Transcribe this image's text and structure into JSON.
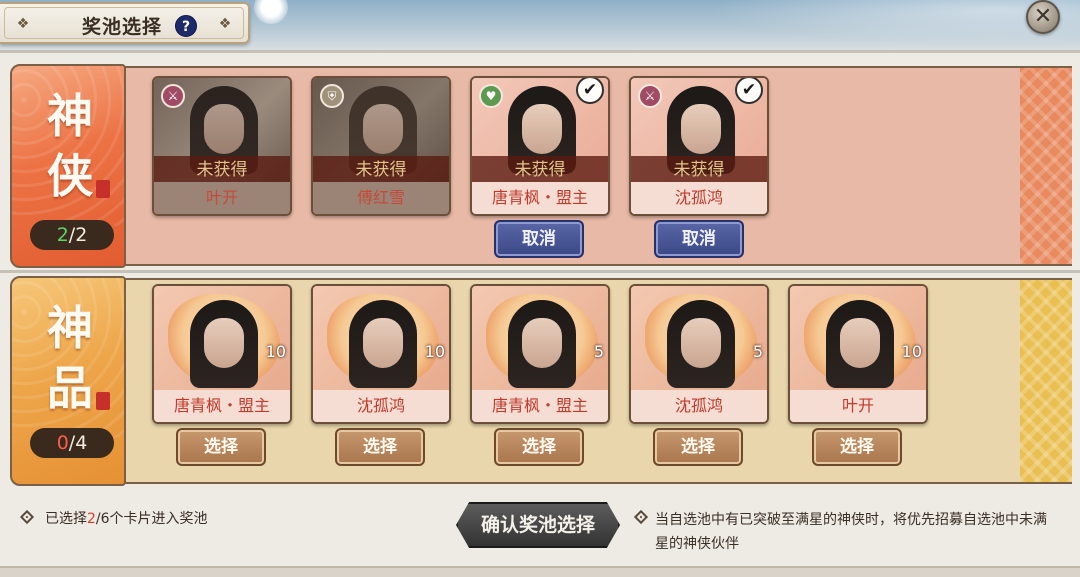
{
  "header": {
    "title": "奖池选择",
    "help_icon": "?",
    "close_icon": "✕"
  },
  "rows": {
    "god": {
      "glyph_top": "神",
      "glyph_bottom": "侠",
      "count_selected": "2",
      "count_total": "2",
      "cards": [
        {
          "status": "未获得",
          "name": "叶开",
          "role": "warrior",
          "selected": false,
          "action": ""
        },
        {
          "status": "未获得",
          "name": "傅红雪",
          "role": "guard",
          "selected": false,
          "action": ""
        },
        {
          "status": "未获得",
          "name": "唐青枫・盟主",
          "role": "heal",
          "selected": true,
          "action": "取消"
        },
        {
          "status": "未获得",
          "name": "沈孤鸿",
          "role": "warrior",
          "selected": true,
          "action": "取消"
        }
      ]
    },
    "item": {
      "glyph_top": "神",
      "glyph_bottom": "品",
      "count_selected": "0",
      "count_total": "4",
      "cards": [
        {
          "name": "唐青枫・盟主",
          "count": "10",
          "action": "选择"
        },
        {
          "name": "沈孤鸿",
          "count": "10",
          "action": "选择"
        },
        {
          "name": "唐青枫・盟主",
          "count": "5",
          "action": "选择"
        },
        {
          "name": "沈孤鸿",
          "count": "5",
          "action": "选择"
        },
        {
          "name": "叶开",
          "count": "10",
          "action": "选择"
        }
      ]
    }
  },
  "footer": {
    "selected_prefix": "已选择",
    "selected_count": "2",
    "selected_suffix": "/6个卡片进入奖池",
    "confirm_label": "确认奖池选择",
    "hint": "当自选池中有已突破至满星的神侠时，将优先招募自选池中未满星的神侠伙伴"
  },
  "colors": {
    "god_row": "#e8b9a6",
    "item_row": "#e9d6ac",
    "cancel_button": "#3c4886",
    "select_button": "#a9764d",
    "confirm_button": "#333333",
    "accent_red": "#e0392f",
    "accent_green": "#5ed26a"
  },
  "icons": {
    "role_warrior": "crossed-swords-icon",
    "role_guard": "shield-icon",
    "role_heal": "heart-icon",
    "selected": "check-icon"
  }
}
